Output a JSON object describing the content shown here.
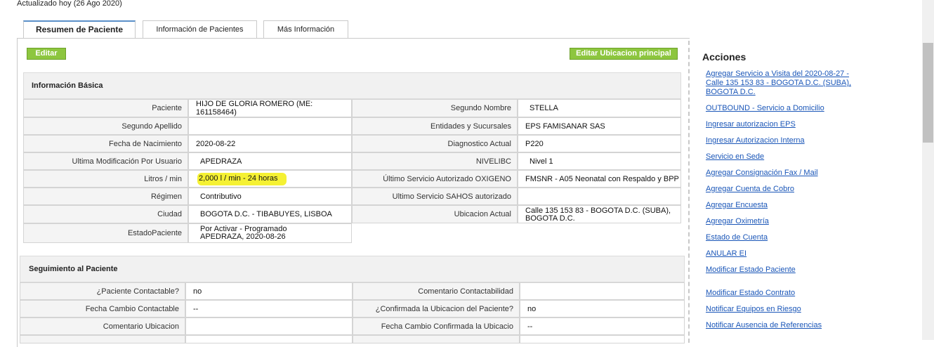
{
  "header": {
    "updated": "Actualizado hoy (26 Ago 2020)"
  },
  "tabs": [
    {
      "label": "Resumen de Paciente"
    },
    {
      "label": "Información de Pacientes"
    },
    {
      "label": "Más Información"
    }
  ],
  "buttons": {
    "edit": "Editar",
    "edit_location": "Editar Ubicacion principal"
  },
  "basic": {
    "title": "Información Básica",
    "left": [
      {
        "label": "Paciente",
        "value": "HIJO DE GLORIA ROMERO (ME: 161158464)"
      },
      {
        "label": "Segundo Apellido",
        "value": ""
      },
      {
        "label": "Fecha de Nacimiento",
        "value": "2020-08-22"
      },
      {
        "label": "Ultima Modificación Por Usuario",
        "value": "APEDRAZA"
      },
      {
        "label": "Litros / min",
        "value": "2,000 l / min - 24 horas"
      },
      {
        "label": "Régimen",
        "value": "Contributivo"
      },
      {
        "label": "Ciudad",
        "value": "BOGOTA D.C. - TIBABUYES, LISBOA"
      },
      {
        "label": "EstadoPaciente",
        "value": "Por Activar - Programado",
        "value2": "APEDRAZA, 2020-08-26"
      }
    ],
    "right": [
      {
        "label": "Segundo Nombre",
        "value": "STELLA"
      },
      {
        "label": "Entidades y Sucursales",
        "value": "EPS FAMISANAR SAS"
      },
      {
        "label": "Diagnostico Actual",
        "value": "P220"
      },
      {
        "label": "NIVELIBC",
        "value": "Nivel 1"
      },
      {
        "label": "Último Servicio Autorizado OXIGENO",
        "value": "FMSNR - A05 Neonatal con Respaldo y BPP"
      },
      {
        "label": "Ultimo Servicio SAHOS autorizado",
        "value": ""
      },
      {
        "label": "Ubicacion Actual",
        "value": "Calle 135 153 83 - BOGOTA D.C. (SUBA),",
        "value2": "BOGOTA D.C."
      }
    ]
  },
  "followup": {
    "title": "Seguimiento al Paciente",
    "left": [
      {
        "label": "¿Paciente Contactable?",
        "value": "no"
      },
      {
        "label": "Fecha Cambio Contactable",
        "value": "--"
      },
      {
        "label": "Comentario Ubicacion",
        "value": ""
      }
    ],
    "right": [
      {
        "label": "Comentario Contactabilidad",
        "value": ""
      },
      {
        "label": "¿Confirmada la Ubicacion del Paciente?",
        "value": "no"
      },
      {
        "label": "Fecha Cambio Confirmada la Ubicacio",
        "value": "--"
      }
    ]
  },
  "actions": {
    "title": "Acciones",
    "links": [
      {
        "line1": "Agregar Servicio a Visita del 2020-08-27 -",
        "line2": "Calle 135 153 83 - BOGOTA D.C. (SUBA),",
        "line3": "BOGOTA D.C."
      },
      {
        "line1": "OUTBOUND - Servicio a Domicilio"
      },
      {
        "line1": "Ingresar autorizacion EPS"
      },
      {
        "line1": "Ingresar Autorizacion Interna"
      },
      {
        "line1": "Servicio en Sede"
      },
      {
        "line1": "Agregar Consignación Fax / Mail"
      },
      {
        "line1": "Agregar Cuenta de Cobro"
      },
      {
        "line1": "Agregar Encuesta"
      },
      {
        "line1": "Agregar Oximetría"
      },
      {
        "line1": "Estado de Cuenta"
      },
      {
        "line1": "ANULAR EI"
      },
      {
        "line1": "Modificar Estado Paciente"
      },
      {
        "line1": "Modificar Estado Contrato"
      },
      {
        "line1": "Notificar Equipos en Riesgo"
      },
      {
        "line1": "Notificar Ausencia de Referencias"
      }
    ]
  }
}
